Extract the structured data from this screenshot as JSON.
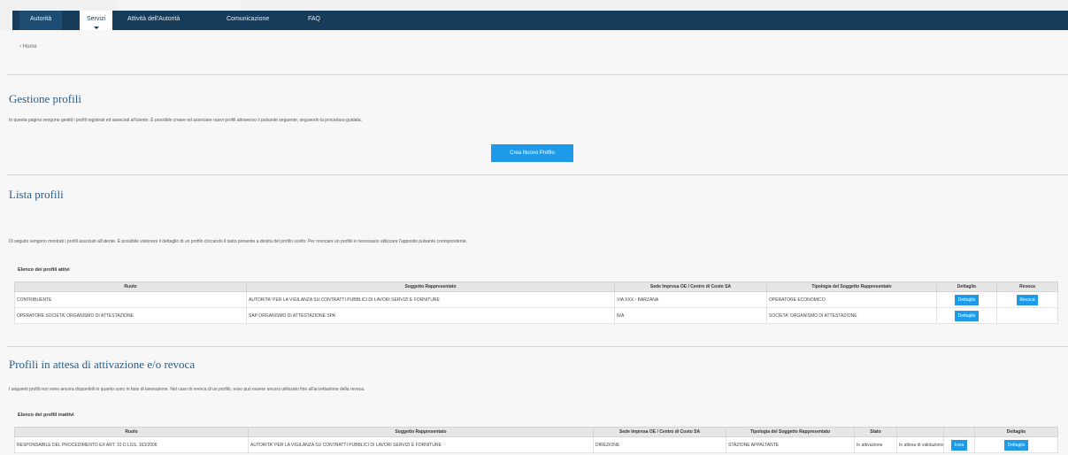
{
  "nav": {
    "items": [
      "Autorità",
      "Servizi",
      "Attività dell'Autorità",
      "Comunicazione",
      "FAQ"
    ],
    "active_index": 1
  },
  "breadcrumb": "› Home",
  "gestione": {
    "title": "Gestione profili",
    "description": "In questa pagina vengono gestiti i profili registrati ed associati all'utente. È possibile creare ed associare nuovi profili attraverso il pulsante seguente, seguendo la procedura guidata.",
    "button_label": "Crea Nuovo Profilo"
  },
  "lista": {
    "title": "Lista profili",
    "description": "Di seguito vengono mostrati i profili associati all'utente. È possibile visionare il dettaglio di un profilo cliccando il tasto presente a destra del profilo scelto. Per revocare un profilo è necessario utilizzare l'apposito pulsante corrispondente.",
    "subhead": "Elenco dei profili attivi",
    "columns": [
      "Ruolo",
      "Soggetto Rappresentato",
      "Sede Impresa OE / Centro di Costo SA",
      "Tipologia del Soggetto Rappresentato",
      "Dettaglio",
      "Revoca"
    ],
    "rows": [
      {
        "ruolo": "CONTRIBUENTE",
        "soggetto": "AUTORITA' PER LA VIGILANZA SU CONTRATTI PUBBLICI DI LAVORI SERVIZI E FORNITURE",
        "sede": "VIA XXX - BARZANA",
        "tipologia": "OPERATORE ECONOMICO",
        "dettaglio": "Dettaglio",
        "revoca": "Revoca"
      },
      {
        "ruolo": "OPERATORE SOCIETA' ORGANISMO DI ATTESTAZIONE",
        "soggetto": "SAP ORGANISMO DI ATTESTAZIONE SPA",
        "sede": "N/A",
        "tipologia": "SOCIETA' ORGANISMO DI ATTESTAZIONE",
        "dettaglio": "Dettaglio",
        "revoca": ""
      }
    ]
  },
  "attesa": {
    "title": "Profili in attesa di attivazione e/o revoca",
    "description": "I seguenti profili non sono ancora disponibili in quanto sono in fase di lavorazione. Nel caso di revoca di un profilo, esso può essere ancora utilizzato fino all'accettazione della revoca.",
    "subhead": "Elenco dei profili inattivi",
    "columns": [
      "Ruolo",
      "Soggetto Rappresentato",
      "Sede Impresa OE / Centro di Costo SA",
      "Tipologia del Soggetto Rappresentato",
      "Stato",
      "",
      "",
      "Dettaglio"
    ],
    "rows": [
      {
        "ruolo": "RESPONSABILE DEL PROCEDIMENTO EX ART. 10 D.LGS. 163/2006",
        "soggetto": "AUTORITA' PER LA VIGILANZA SU CONTRATTI PUBBLICI DI LAVORI SERVIZI E FORNITURE",
        "sede": "DIREZIONE",
        "tipologia": "STAZIONE APPALTANTE",
        "stato": "In attivazione",
        "stato_note": "In attesa di validazione",
        "azione": "Invia",
        "dettaglio": "Dettaglio"
      }
    ]
  },
  "colors": {
    "nav_bg": "#163c5a",
    "accent": "#1e9be8",
    "title": "#2a5d86"
  }
}
